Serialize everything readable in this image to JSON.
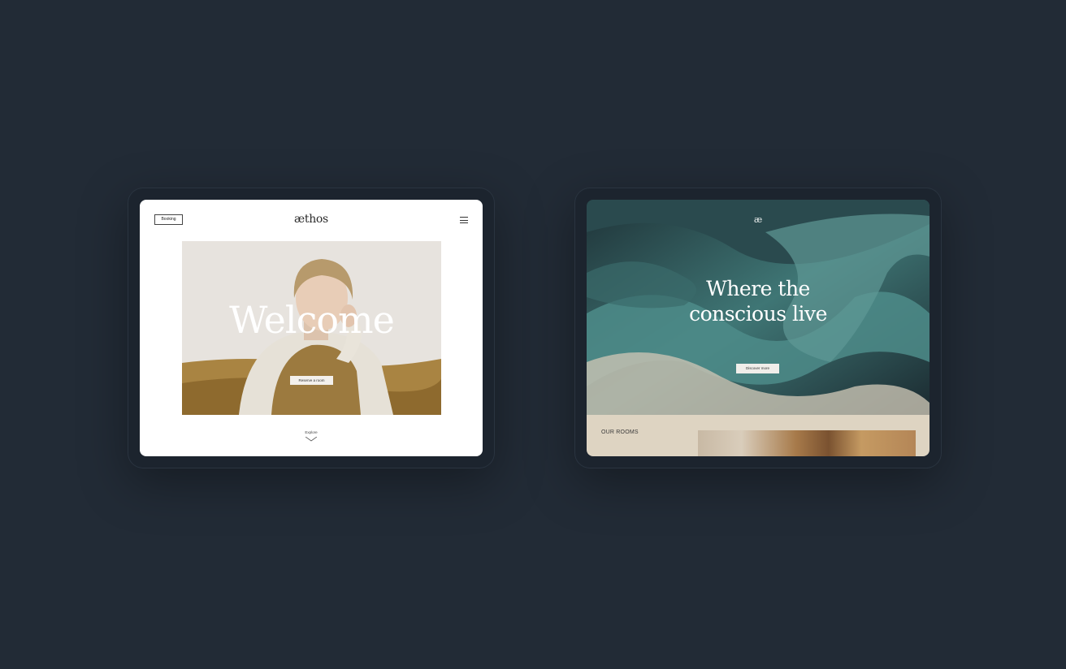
{
  "left_screen": {
    "booking_label": "Booking",
    "logo": "æthos",
    "hero_title": "Welcome",
    "reserve_label": "Reserve a room",
    "explore_label": "Explore"
  },
  "right_screen": {
    "logo": "æ",
    "headline_line1": "Where the",
    "headline_line2": "conscious live",
    "discover_label": "Discover more",
    "rooms_label": "OUR ROOMS"
  },
  "colors": {
    "background": "#222b36",
    "frame": "#1c242e",
    "teal": "#4f8a88",
    "beige": "#ded4c2"
  },
  "icons": [
    "menu-icon",
    "chevron-down-icon"
  ]
}
